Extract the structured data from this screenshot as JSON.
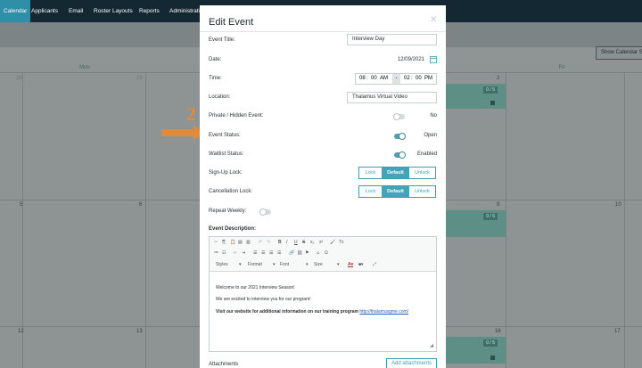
{
  "nav": {
    "items": [
      "Calendar",
      "Applicants",
      "Email",
      "Roster Layouts",
      "Reports",
      "Administration"
    ]
  },
  "calendar": {
    "show_button": "Show Calendar Sta",
    "days": [
      "Mon",
      "Fri"
    ],
    "week1": {
      "d1": "28",
      "d2": "29",
      "d5": "2"
    },
    "week2": {
      "d1": "5",
      "d2": "6",
      "d5": "9",
      "d6": "10"
    },
    "week3": {
      "d1": "12",
      "d2": "13",
      "d5": "16",
      "d6": "17"
    },
    "event_badge": "0 / 5"
  },
  "annotation": {
    "number": "2"
  },
  "modal": {
    "title": "Edit Event",
    "close_icon": "close-icon",
    "fields": {
      "event_title_label": "Event Title:",
      "event_title_value": "Interview Day",
      "date_label": "Date:",
      "date_value": "12/09/2021",
      "time_label": "Time:",
      "time_start_hour": "08",
      "time_start_min": "00",
      "time_start_ampm": "AM",
      "time_sep": "-",
      "time_end_hour": "02",
      "time_end_min": "00",
      "time_end_ampm": "PM",
      "location_label": "Location:",
      "location_value": "Thalamus Virtual Video",
      "private_label": "Private / Hidden Event:",
      "private_value": "No",
      "event_status_label": "Event Status:",
      "event_status_value": "Open",
      "waitlist_label": "Waitlist Status:",
      "waitlist_value": "Enabled",
      "signup_lock_label": "Sign-Up Lock:",
      "cancellation_lock_label": "Cancellation Lock:",
      "repeat_weekly_label": "Repeat Weekly:",
      "event_description_label": "Event Description:",
      "attachments_label": "Attachments"
    },
    "lock_options": {
      "lock": "Lock",
      "default": "Default",
      "unlock": "Unlock"
    },
    "editor": {
      "dropdowns": {
        "styles": "Styles",
        "format": "Format",
        "font": "Font",
        "size": "Size"
      },
      "line1": "Welcome to our 2021 Interview Season!",
      "line2": "We are excited to interview you for our program!",
      "line3_bold": "Visit our website for additional information on our training program",
      "link": "http://thalamusgme.com/"
    },
    "add_attachments": "Add attachments"
  },
  "colors": {
    "accent": "#45a3b8",
    "nav_bg": "#142834",
    "arrow": "#e08a3c"
  }
}
